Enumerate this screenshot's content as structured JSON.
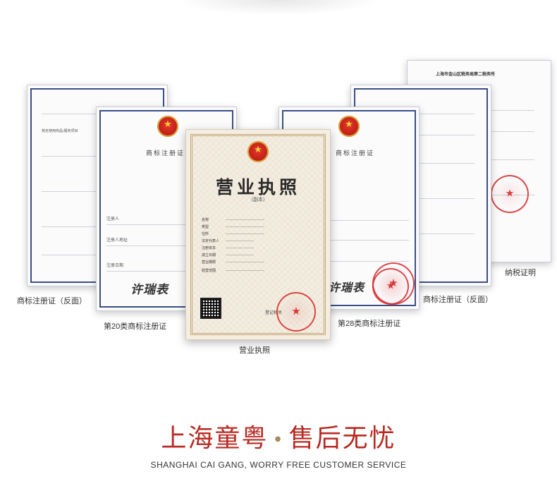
{
  "certificates": {
    "far_left": {
      "caption": "商标注册证（反面）",
      "header_line": "核定使用商品/服务项目"
    },
    "left": {
      "caption": "第20类商标注册证",
      "title": "商标注册证",
      "fields": [
        "注册人",
        "注册人地址",
        "注册日期"
      ],
      "signature": "许瑞表"
    },
    "center": {
      "caption": "营业执照",
      "title": "营业执照",
      "subtitle": "（副本）",
      "fields": [
        "名称",
        "类型",
        "住所",
        "法定代表人",
        "注册资本",
        "成立日期",
        "营业期限",
        "经营范围"
      ],
      "authority": "登记机关"
    },
    "right": {
      "caption": "第28类商标注册证",
      "title": "商标注册证",
      "signature": "许瑞表"
    },
    "far_right_back": {
      "caption": "商标注册证（反面）"
    },
    "tax": {
      "caption": "纳税证明",
      "header": "上海市金山区税务局第二税务所"
    }
  },
  "footer": {
    "slogan_left": "上海童粤",
    "slogan_dot": "•",
    "slogan_right": "售后无忧",
    "subtitle": "SHANGHAI CAI GANG, WORRY FREE CUSTOMER SERVICE"
  },
  "colors": {
    "accent": "#b92a22",
    "frame_blue": "#3b4f86",
    "license_paper": "#f3ede2"
  }
}
